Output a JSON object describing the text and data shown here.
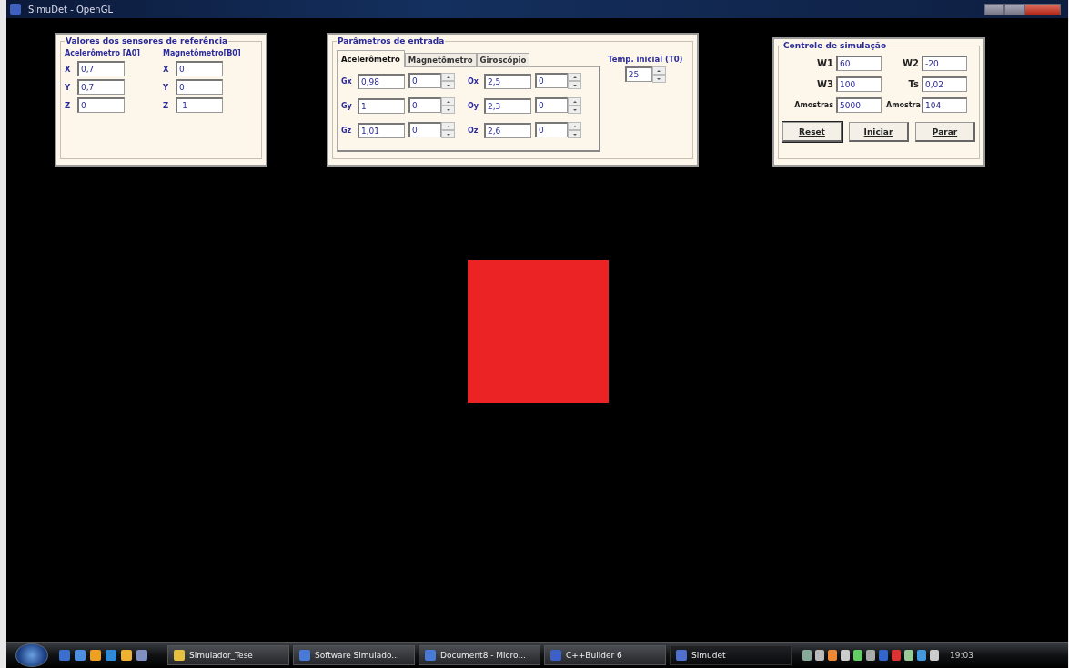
{
  "window": {
    "title": "SimuDet - OpenGL"
  },
  "reference_panel": {
    "title": "Valores dos sensores de referência",
    "groups": [
      {
        "heading": "Acelerômetro [A0]",
        "fields": [
          {
            "label": "X",
            "value": "0,7"
          },
          {
            "label": "Y",
            "value": "0,7"
          },
          {
            "label": "Z",
            "value": "0"
          }
        ]
      },
      {
        "heading": "Magnetômetro[B0]",
        "fields": [
          {
            "label": "X",
            "value": "0"
          },
          {
            "label": "Y",
            "value": "0"
          },
          {
            "label": "Z",
            "value": "-1"
          }
        ]
      }
    ]
  },
  "input_panel": {
    "title": "Parâmetros de entrada",
    "tabs": [
      {
        "label": "Acelerômetro",
        "selected": true
      },
      {
        "label": "Magnetômetro",
        "selected": false
      },
      {
        "label": "Giroscópio",
        "selected": false
      }
    ],
    "columns": [
      [
        {
          "label": "Gx",
          "value": "0,98",
          "spin": "0"
        },
        {
          "label": "Gy",
          "value": "1",
          "spin": "0"
        },
        {
          "label": "Gz",
          "value": "1,01",
          "spin": "0"
        }
      ],
      [
        {
          "label": "Ox",
          "value": "2,5",
          "spin": "0"
        },
        {
          "label": "Oy",
          "value": "2,3",
          "spin": "0"
        },
        {
          "label": "Oz",
          "value": "2,6",
          "spin": "0"
        }
      ]
    ],
    "initial_temp": {
      "label": "Temp. inicial (T0)",
      "value": "25"
    }
  },
  "control_panel": {
    "title": "Controle de simulação",
    "fields": [
      {
        "label": "W1",
        "value": "60"
      },
      {
        "label": "W2",
        "value": "-20"
      },
      {
        "label": "W3",
        "value": "100"
      },
      {
        "label": "Ts",
        "value": "0,02"
      },
      {
        "label": "Amostras",
        "value": "5000"
      },
      {
        "label": "Amostra",
        "value": "104"
      }
    ],
    "buttons": [
      {
        "label": "Reset",
        "focused": true
      },
      {
        "label": "Iniciar",
        "focused": false
      },
      {
        "label": "Parar",
        "focused": false
      }
    ]
  },
  "taskbar": {
    "items": [
      {
        "label": "Simulador_Tese",
        "kind": "folder",
        "selected": false
      },
      {
        "label": "Software Simulado...",
        "kind": "document",
        "selected": false
      },
      {
        "label": "Document8 - Micro...",
        "kind": "document",
        "selected": false
      },
      {
        "label": "C++Builder 6",
        "kind": "builder",
        "selected": false
      },
      {
        "label": "Simudet",
        "kind": "app",
        "selected": true
      }
    ],
    "clock": "19:03"
  }
}
